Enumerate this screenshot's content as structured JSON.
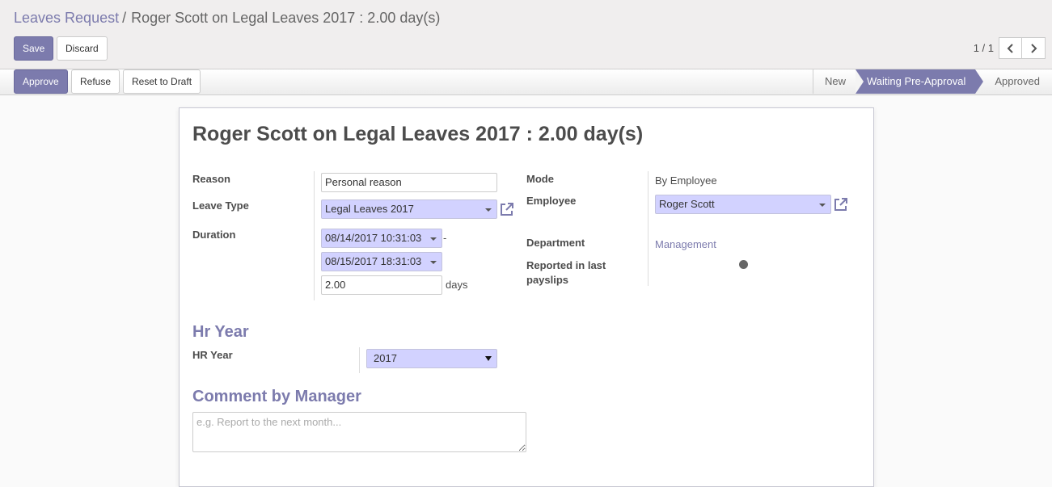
{
  "breadcrumb": {
    "parent": "Leaves Request",
    "separator": "/",
    "current": "Roger Scott on Legal Leaves 2017 : 2.00 day(s)"
  },
  "buttons": {
    "save": "Save",
    "discard": "Discard",
    "approve": "Approve",
    "refuse": "Refuse",
    "reset_to_draft": "Reset to Draft"
  },
  "pager": {
    "value": "1 / 1"
  },
  "stages": [
    {
      "label": "New",
      "active": false
    },
    {
      "label": "Waiting Pre-Approval",
      "active": true
    },
    {
      "label": "Approved",
      "active": false
    }
  ],
  "form": {
    "title": "Roger Scott on Legal Leaves 2017 : 2.00 day(s)",
    "reason_label": "Reason",
    "reason_value": "Personal reason",
    "leave_type_label": "Leave Type",
    "leave_type_value": "Legal Leaves 2017",
    "duration_label": "Duration",
    "date_from": "08/14/2017 10:31:03",
    "date_sep": "-",
    "date_to": "08/15/2017 18:31:03",
    "days_value": "2.00",
    "days_unit": "days",
    "mode_label": "Mode",
    "mode_value": "By Employee",
    "employee_label": "Employee",
    "employee_value": "Roger Scott",
    "department_label": "Department",
    "department_value": "Management",
    "reported_label": "Reported in last payslips",
    "hr_year_section": "Hr Year",
    "hr_year_label": "HR Year",
    "hr_year_value": "2017",
    "comment_section": "Comment by Manager",
    "comment_placeholder": "e.g. Report to the next month..."
  },
  "colors": {
    "brand": "#7c7bad",
    "required_field": "#d2d2ff"
  }
}
